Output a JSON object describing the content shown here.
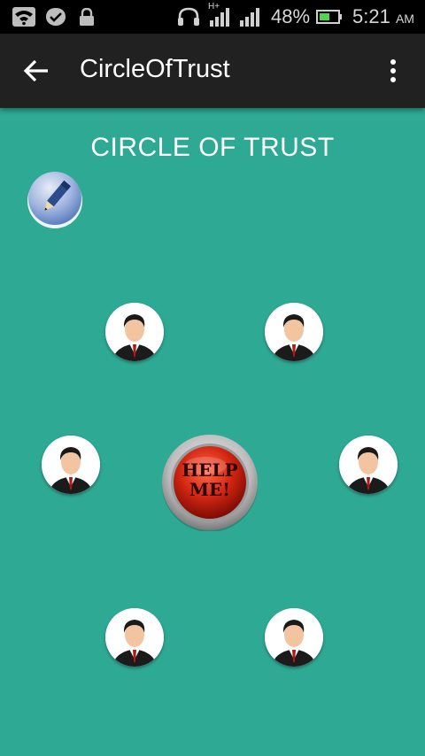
{
  "status_bar": {
    "network_type": "H+",
    "battery_percent": "48%",
    "time": "5:21",
    "ampm": "AM"
  },
  "app_bar": {
    "title": "CircleOfTrust"
  },
  "main": {
    "heading": "CIRCLE OF TRUST",
    "help_button": {
      "line1": "HELP",
      "line2": "ME!"
    },
    "contacts_count": 6
  },
  "colors": {
    "background": "#2ea993",
    "app_bar": "#212121",
    "status_bar": "#000000",
    "help_red": "#c21f12"
  },
  "icons": [
    "wifi-icon",
    "checkmark-icon",
    "lock-icon",
    "headphones-icon",
    "signal-icon",
    "battery-icon",
    "back-arrow-icon",
    "overflow-menu-icon",
    "pencil-icon",
    "person-avatar-icon"
  ]
}
